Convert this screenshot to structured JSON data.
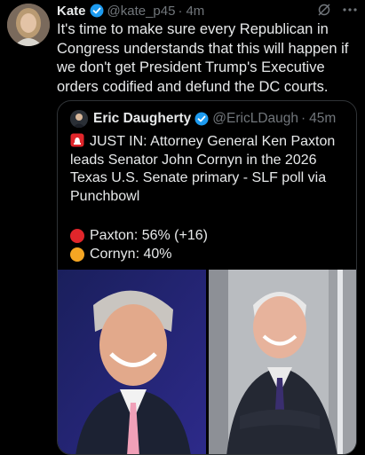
{
  "tweet": {
    "author_name": "Kate",
    "handle": "@kate_p45",
    "separator": "·",
    "time": "4m",
    "text": "It's time to make sure every Republican in Congress understands that this will happen if we don't get President Trump's Executive orders codified and defund the DC courts."
  },
  "quote": {
    "author_name": "Eric Daugherty",
    "handle": "@EricLDaugh",
    "separator": "·",
    "time": "45m",
    "headline": "JUST IN: Attorney General Ken Paxton leads Senator John Cornyn in the 2026 Texas U.S. Senate primary - SLF poll via Punchbowl",
    "poll": [
      {
        "label": "Paxton: 56% (+16)",
        "dot_color": "#e0262b"
      },
      {
        "label": "Cornyn: 40%",
        "dot_color": "#f5a623"
      }
    ]
  },
  "colors": {
    "background": "#000000",
    "text": "#e7e9ea",
    "secondary_text": "#71767b",
    "verified_blue": "#1d9bf0",
    "border": "#2f3336"
  }
}
